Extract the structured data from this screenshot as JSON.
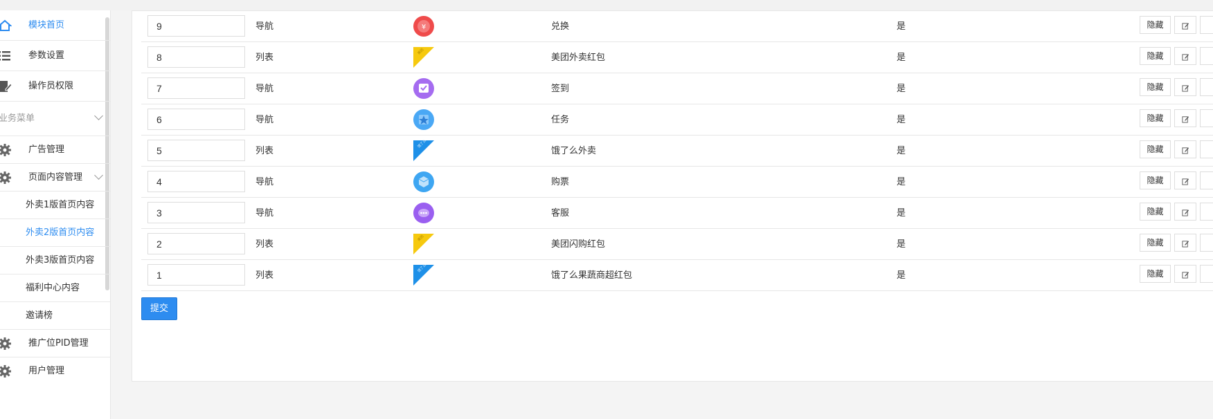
{
  "sidebar": {
    "items": [
      {
        "label": "模块首页",
        "icon": "home-icon",
        "active": true
      },
      {
        "label": "参数设置",
        "icon": "list-icon",
        "active": false
      },
      {
        "label": "操作员权限",
        "icon": "edit-doc-icon",
        "active": false
      }
    ],
    "group_label": "业务菜单",
    "group_items": [
      {
        "label": "广告管理",
        "icon": "gear-icon"
      },
      {
        "label": "页面内容管理",
        "icon": "gear-icon"
      }
    ],
    "sub_items": [
      {
        "label": "外卖1版首页内容",
        "active": false
      },
      {
        "label": "外卖2版首页内容",
        "active": true
      },
      {
        "label": "外卖3版首页内容",
        "active": false
      },
      {
        "label": "福利中心内容",
        "active": false
      },
      {
        "label": "邀请榜",
        "active": false
      }
    ],
    "bottom_items": [
      {
        "label": "推广位PID管理",
        "icon": "gear-icon"
      },
      {
        "label": "用户管理",
        "icon": "gear-icon"
      }
    ]
  },
  "table": {
    "rows": [
      {
        "sort": "9",
        "type": "导航",
        "image": "exchange-icon",
        "name": "兑换",
        "show": "是"
      },
      {
        "sort": "8",
        "type": "列表",
        "image": "meituan-badge-icon",
        "name": "美团外卖红包",
        "show": "是"
      },
      {
        "sort": "7",
        "type": "导航",
        "image": "checkin-icon",
        "name": "签到",
        "show": "是"
      },
      {
        "sort": "6",
        "type": "导航",
        "image": "task-icon",
        "name": "任务",
        "show": "是"
      },
      {
        "sort": "5",
        "type": "列表",
        "image": "eleme-badge-icon",
        "name": "饿了么外卖",
        "show": "是"
      },
      {
        "sort": "4",
        "type": "导航",
        "image": "ticket-icon",
        "name": "购票",
        "show": "是"
      },
      {
        "sort": "3",
        "type": "导航",
        "image": "service-icon",
        "name": "客服",
        "show": "是"
      },
      {
        "sort": "2",
        "type": "列表",
        "image": "meituan-badge-icon",
        "name": "美团闪购红包",
        "show": "是"
      },
      {
        "sort": "1",
        "type": "列表",
        "image": "eleme-badge-icon",
        "name": "饿了么果蔬商超红包",
        "show": "是"
      }
    ],
    "hide_label": "隐藏",
    "submit_label": "提交"
  },
  "colors": {
    "accent": "#2d8cf0",
    "meituan": "#f6c90e",
    "eleme": "#1e90e8"
  }
}
